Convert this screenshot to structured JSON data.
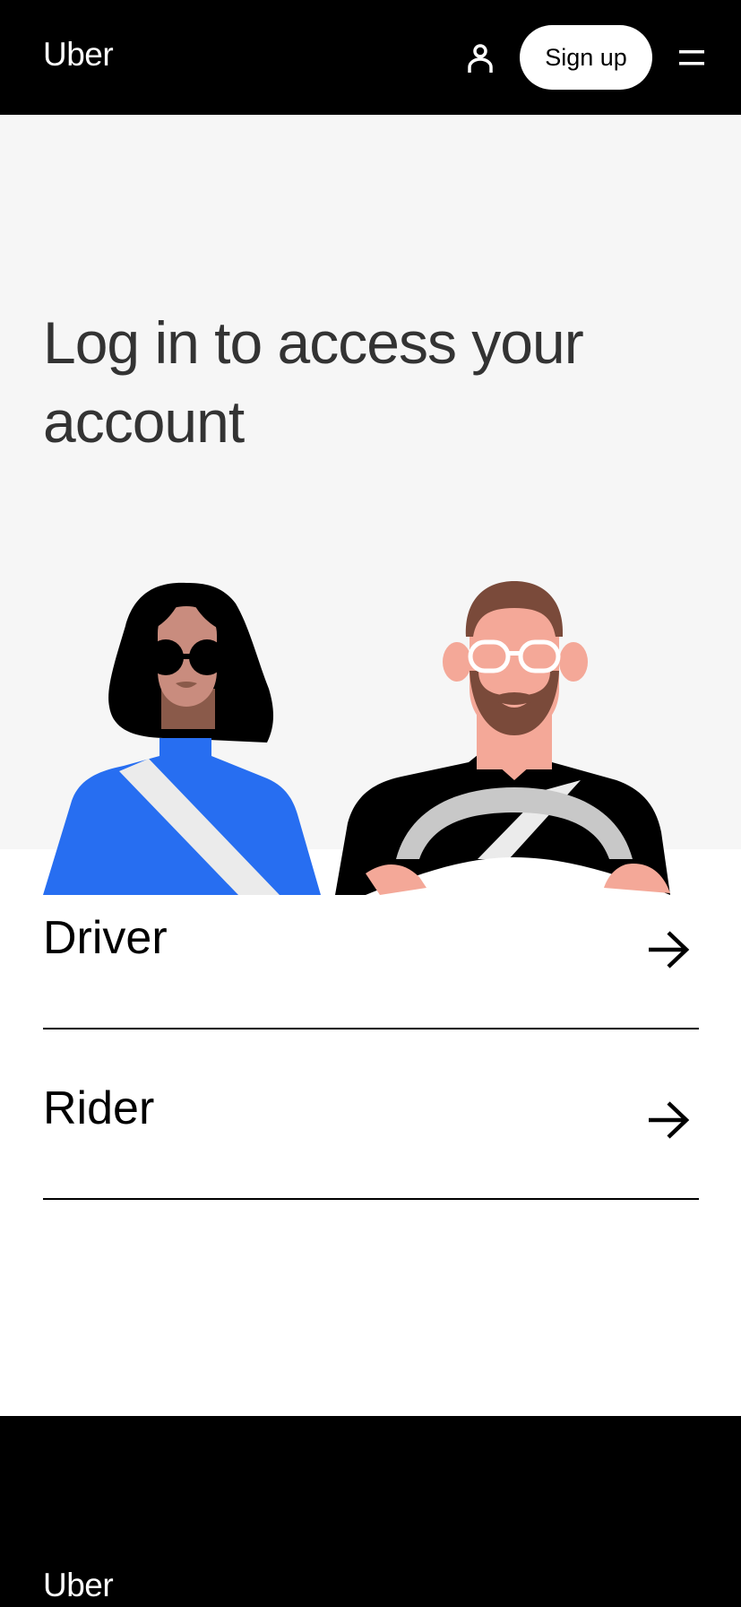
{
  "header": {
    "logo": "Uber",
    "signup_label": "Sign up",
    "icons": {
      "account": "person-icon",
      "menu": "hamburger-menu-icon"
    }
  },
  "hero": {
    "title": "Log in to access your account",
    "illustration": "rider-and-driver-illustration"
  },
  "roles": [
    {
      "label": "Driver",
      "icon": "arrow-right-icon"
    },
    {
      "label": "Rider",
      "icon": "arrow-right-icon"
    }
  ],
  "footer": {
    "logo": "Uber"
  },
  "colors": {
    "header_bg": "#000000",
    "hero_bg": "#f6f6f6",
    "rider_shirt": "#276ef1",
    "driver_beard": "#7a4a3a",
    "skin_driver": "#f4a898",
    "skin_rider": "#c98c7e"
  }
}
